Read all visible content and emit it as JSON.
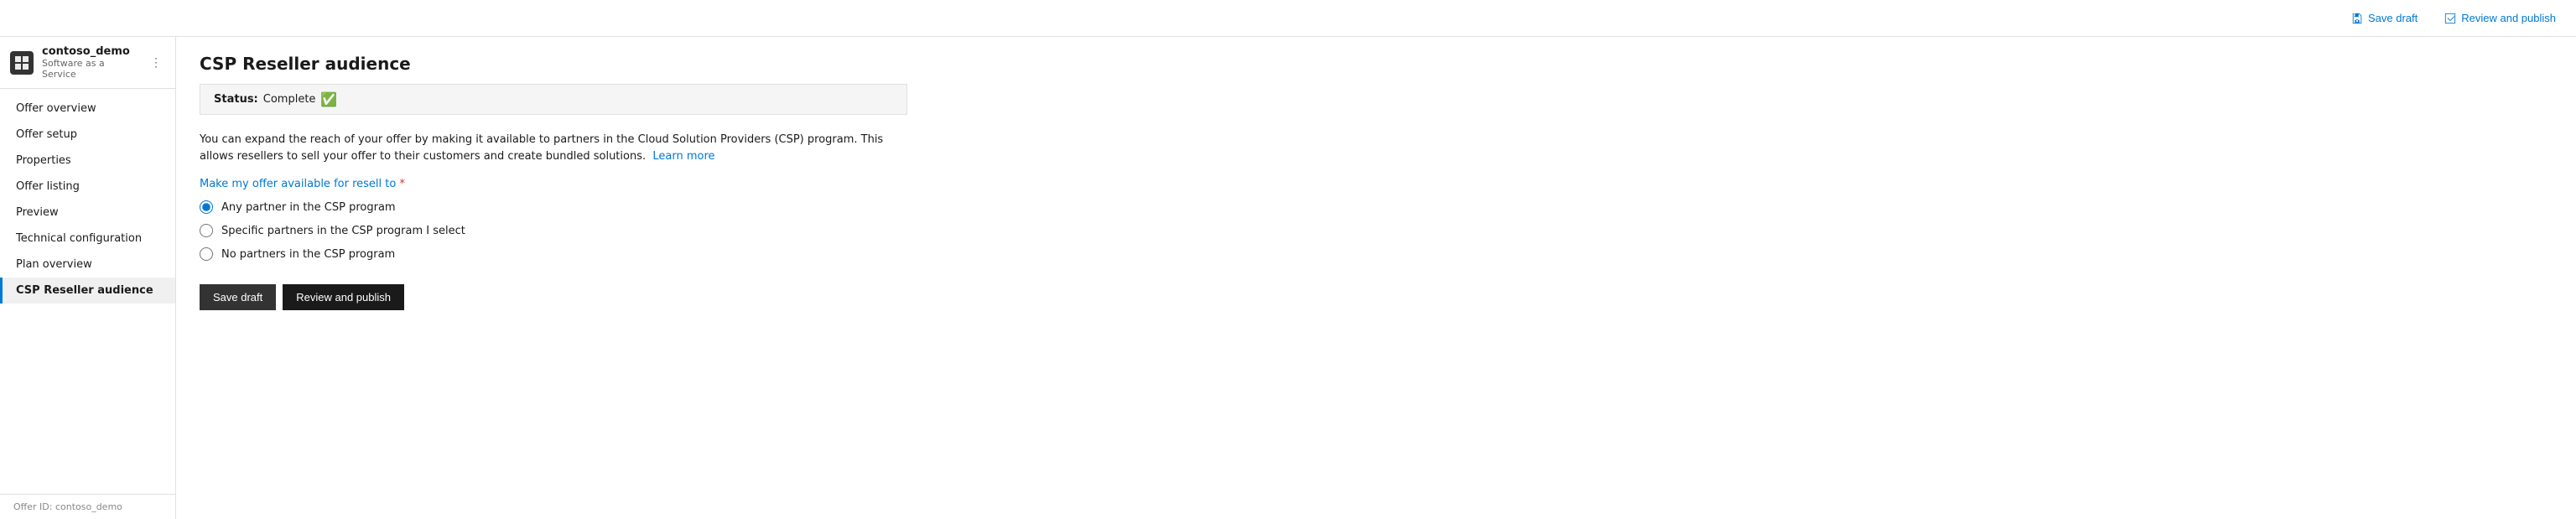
{
  "app": {
    "org_name": "contoso_demo",
    "org_subtitle": "Software as a Service",
    "logo_icon": "grid-icon"
  },
  "top_bar": {
    "save_draft_label": "Save draft",
    "review_publish_label": "Review and publish"
  },
  "sidebar": {
    "items": [
      {
        "id": "offer-overview",
        "label": "Offer overview",
        "active": false
      },
      {
        "id": "offer-setup",
        "label": "Offer setup",
        "active": false
      },
      {
        "id": "properties",
        "label": "Properties",
        "active": false
      },
      {
        "id": "offer-listing",
        "label": "Offer listing",
        "active": false
      },
      {
        "id": "preview",
        "label": "Preview",
        "active": false
      },
      {
        "id": "technical-configuration",
        "label": "Technical configuration",
        "active": false
      },
      {
        "id": "plan-overview",
        "label": "Plan overview",
        "active": false
      },
      {
        "id": "csp-reseller-audience",
        "label": "CSP Reseller audience",
        "active": true
      }
    ],
    "offer_id_label": "Offer ID: contoso_demo"
  },
  "content": {
    "page_title": "CSP Reseller audience",
    "status": {
      "label": "Status:",
      "value": "Complete"
    },
    "description": "You can expand the reach of your offer by making it available to partners in the Cloud Solution Providers (CSP) program. This allows resellers to sell your offer to their customers and create bundled solutions.",
    "learn_more_label": "Learn more",
    "radio_section_label": "Make my offer available for resell to",
    "radio_options": [
      {
        "id": "any-partner",
        "label": "Any partner in the CSP program",
        "checked": true
      },
      {
        "id": "specific-partners",
        "label": "Specific partners in the CSP program I select",
        "checked": false
      },
      {
        "id": "no-partners",
        "label": "No partners in the CSP program",
        "checked": false
      }
    ],
    "save_draft_label": "Save draft",
    "review_publish_label": "Review and publish"
  }
}
